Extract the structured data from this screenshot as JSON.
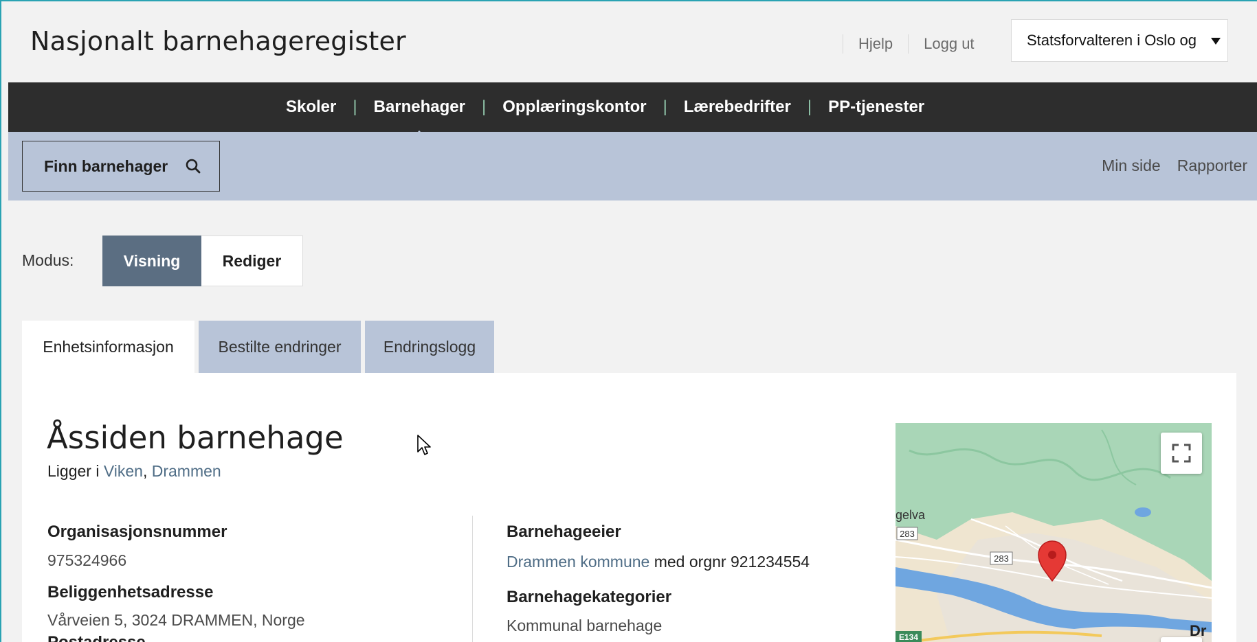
{
  "header": {
    "site_title": "Nasjonalt barnehageregister",
    "help_link": "Hjelp",
    "logout_link": "Logg ut",
    "org_select": {
      "value": "Statsforvalteren i Oslo og"
    }
  },
  "nav": {
    "items": [
      {
        "label": "Skoler",
        "active": false
      },
      {
        "label": "Barnehager",
        "active": true
      },
      {
        "label": "Opplæringskontor",
        "active": false
      },
      {
        "label": "Lærebedrifter",
        "active": false
      },
      {
        "label": "PP-tjenester",
        "active": false
      }
    ]
  },
  "subbar": {
    "find_label": "Finn barnehager",
    "links": [
      "Min side",
      "Rapporter"
    ]
  },
  "mode": {
    "label": "Modus:",
    "view_label": "Visning",
    "edit_label": "Rediger",
    "active": "Visning"
  },
  "tabs": [
    {
      "label": "Enhetsinformasjon",
      "active": true
    },
    {
      "label": "Bestilte endringer",
      "active": false
    },
    {
      "label": "Endringslogg",
      "active": false
    }
  ],
  "unit": {
    "name": "Åssiden barnehage",
    "located_prefix": "Ligger i",
    "county": "Viken",
    "separator": ",",
    "municipality": "Drammen",
    "fields": {
      "org_number_label": "Organisasjonsnummer",
      "org_number_value": "975324966",
      "address_label": "Beliggenhetsadresse",
      "address_value": "Vårveien 5, 3024 DRAMMEN, Norge",
      "postal_label_partial": "Postadresse",
      "owner_label": "Barnehageeier",
      "owner_name": "Drammen kommune",
      "owner_suffix": "med orgnr 921234554",
      "category_label": "Barnehagekategorier",
      "category_value": "Kommunal barnehage"
    }
  },
  "map": {
    "labels": {
      "river_label": "gelva",
      "road_283_a": "283",
      "road_283_b": "283",
      "road_e134": "E134",
      "town_partial": "Dr"
    },
    "colors": {
      "forest": "#a9d6b7",
      "urban": "#efe5d0",
      "water": "#6fa6e0",
      "marker": "#e53935"
    }
  },
  "colors": {
    "nav_bg": "#2d2d2d",
    "subbar_bg": "#b8c4d8",
    "nav_separator": "#8fc3a8",
    "mode_active_bg": "#5b6e82",
    "link": "#4f6d86"
  }
}
